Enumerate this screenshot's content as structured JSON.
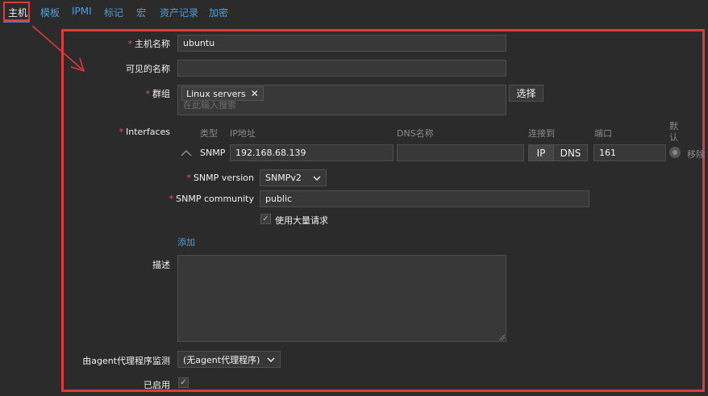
{
  "tabs": [
    {
      "label": "主机"
    },
    {
      "label": "模板"
    },
    {
      "label": "IPMI"
    },
    {
      "label": "标记"
    },
    {
      "label": "宏"
    },
    {
      "label": "资产记录"
    },
    {
      "label": "加密"
    }
  ],
  "form": {
    "hostname_label": "主机名称",
    "hostname_value": "ubuntu",
    "visible_name_label": "可见的名称",
    "groups_label": "群组",
    "group_tag": "Linux servers",
    "groups_placeholder": "在此输入搜索",
    "select_button": "选择",
    "interfaces_label": "Interfaces",
    "col_type": "类型",
    "col_ip": "IP地址",
    "col_dns": "DNS名称",
    "col_connect": "连接到",
    "col_port": "端口",
    "col_default": "默认",
    "interface": {
      "type": "SNMP",
      "ip": "192.168.68.139",
      "dns": "",
      "connect_ip": "IP",
      "connect_dns": "DNS",
      "port": "161",
      "remove": "移除"
    },
    "snmp_version_label": "SNMP version",
    "snmp_version_value": "SNMPv2",
    "snmp_community_label": "SNMP community",
    "snmp_community_value": "public",
    "bulk_label": "使用大量请求",
    "add_link": "添加",
    "description_label": "描述",
    "proxy_label": "由agent代理程序监测",
    "proxy_value": "(无agent代理程序)",
    "enabled_label": "已启用"
  }
}
